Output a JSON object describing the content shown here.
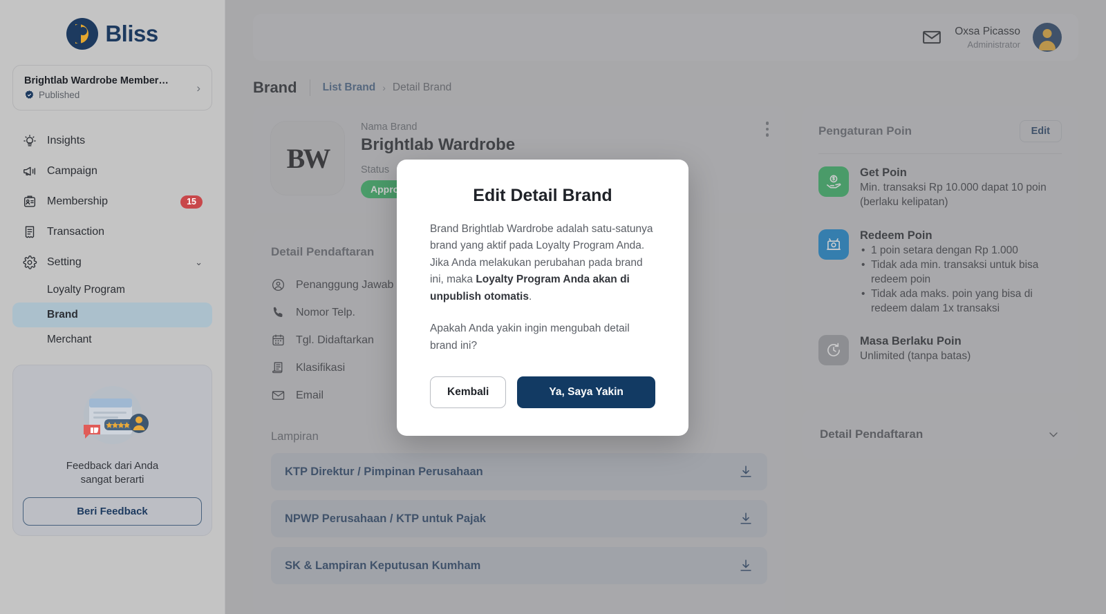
{
  "brand": {
    "name": "Bliss"
  },
  "sidebar": {
    "program": {
      "title": "Brightlab Wardrobe Member…",
      "status": "Published"
    },
    "items": [
      {
        "label": "Insights",
        "icon": "insights-icon",
        "badge": null
      },
      {
        "label": "Campaign",
        "icon": "megaphone-icon",
        "badge": null
      },
      {
        "label": "Membership",
        "icon": "id-card-icon",
        "badge": "15"
      },
      {
        "label": "Transaction",
        "icon": "receipt-icon",
        "badge": null
      },
      {
        "label": "Setting",
        "icon": "gear-icon",
        "badge": null
      }
    ],
    "sub_items": [
      {
        "label": "Loyalty Program",
        "active": false
      },
      {
        "label": "Brand",
        "active": true
      },
      {
        "label": "Merchant",
        "active": false
      }
    ],
    "feedback": {
      "text": "Feedback dari Anda\nsangat berarti",
      "line1": "Feedback dari Anda",
      "line2": "sangat berarti",
      "button": "Beri Feedback"
    }
  },
  "header": {
    "mail_icon": "mail-icon",
    "user_name": "Oxsa Picasso",
    "user_role": "Administrator"
  },
  "page": {
    "title": "Brand",
    "breadcrumb_link": "List Brand",
    "breadcrumb_sep": "›",
    "breadcrumb_current": "Detail Brand"
  },
  "brand_card": {
    "logo_text": "BW",
    "name_label": "Nama Brand",
    "name_value": "Brightlab Wardrobe",
    "status_label": "Status",
    "status_value": "Approved"
  },
  "detail": {
    "section_title": "Detail Pendaftaran",
    "rows": [
      {
        "label": "Penanggung Jawab",
        "icon": "person-circle-icon"
      },
      {
        "label": "Nomor Telp.",
        "icon": "phone-icon"
      },
      {
        "label": "Tgl. Didaftarkan",
        "icon": "calendar-icon"
      },
      {
        "label": "Klasifikasi",
        "icon": "document-icon"
      },
      {
        "label": "Email",
        "icon": "mail-icon"
      }
    ],
    "lampiran_title": "Lampiran",
    "attachments": [
      {
        "name": "KTP Direktur / Pimpinan Perusahaan",
        "icon": "download-icon"
      },
      {
        "name": "NPWP Perusahaan / KTP untuk Pajak",
        "icon": "download-icon"
      },
      {
        "name": "SK & Lampiran Keputusan Kumham",
        "icon": "download-icon"
      }
    ]
  },
  "points": {
    "title": "Pengaturan Poin",
    "edit_label": "Edit",
    "get": {
      "title": "Get Poin",
      "desc": "Min. transaksi Rp 10.000 dapat 10 poin (berlaku kelipatan)",
      "color": "#2eb05e",
      "icon": "get-point-icon"
    },
    "redeem": {
      "title": "Redeem Poin",
      "bullets": [
        "1 poin setara dengan Rp 1.000",
        "Tidak ada min. transaksi untuk bisa redeem poin",
        "Tidak ada maks. poin yang bisa di redeem dalam 1x transaksi"
      ],
      "color": "#0c82cd",
      "icon": "redeem-point-icon"
    },
    "expiry": {
      "title": "Masa Berlaku Poin",
      "desc": "Unlimited (tanpa batas)",
      "color": "#9a9ca1",
      "icon": "clock-refresh-icon"
    }
  },
  "collapse_card": {
    "title": "Detail Pendaftaran",
    "icon": "chevron-down-icon"
  },
  "modal": {
    "title": "Edit Detail Brand",
    "paragraph1_pre": "Brand Brightlab Wardrobe adalah satu-satunya brand yang aktif pada Loyalty Program Anda. Jika Anda melakukan perubahan pada brand ini, maka ",
    "paragraph1_bold": "Loyalty Program Anda akan di unpublish otomatis",
    "paragraph1_post": ".",
    "paragraph2": "Apakah Anda yakin ingin mengubah detail brand ini?",
    "cancel_label": "Kembali",
    "confirm_label": "Ya, Saya Yakin",
    "confirm_color": "#123a63"
  }
}
